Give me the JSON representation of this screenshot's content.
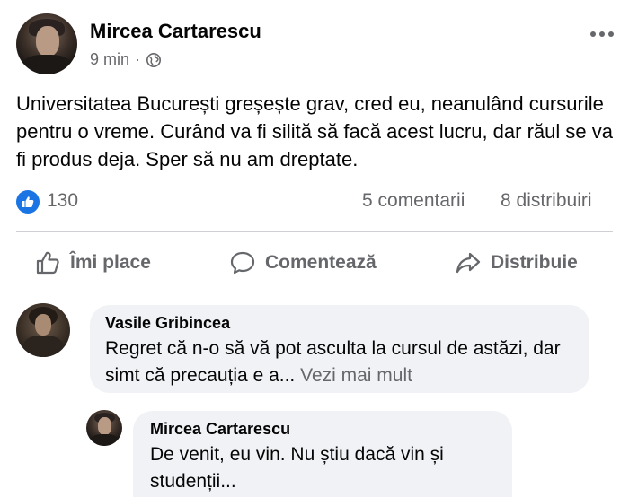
{
  "post": {
    "author": "Mircea Cartarescu",
    "time": "9 min",
    "separator": "·",
    "audience_icon": "globe-icon",
    "more_icon": "more-icon",
    "text": "Universitatea București greșește grav, cred eu, neanulând cursurile pentru o vreme. Curând va fi silită să facă acest lucru, dar răul se va fi produs deja. Sper să nu am dreptate."
  },
  "stats": {
    "reaction_icon": "like-reaction-icon",
    "likes": "130",
    "comments": "5 comentarii",
    "shares": "8 distribuiri"
  },
  "actions": {
    "like": "Îmi place",
    "comment": "Comentează",
    "share": "Distribuie"
  },
  "comments": [
    {
      "author": "Vasile Gribincea",
      "text": "Regret că n-o să vă pot asculta la cursul de astăzi, dar simt că precauția e a...",
      "see_more": "Vezi mai mult"
    },
    {
      "author": "Mircea Cartarescu",
      "text": "De venit, eu vin. Nu știu dacă vin și studenții..."
    }
  ],
  "colors": {
    "brand_blue": "#1b74e4",
    "secondary_text": "#65676b",
    "bubble_bg": "#f0f2f5"
  }
}
